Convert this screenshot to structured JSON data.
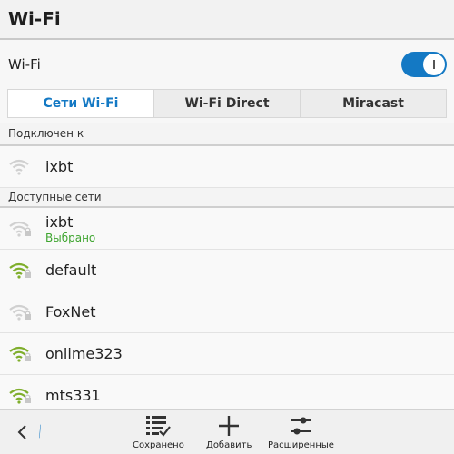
{
  "header": {
    "title": "Wi-Fi"
  },
  "wifi_toggle": {
    "label": "Wi-Fi",
    "on": true
  },
  "tabs": [
    {
      "label": "Сети Wi-Fi",
      "active": true
    },
    {
      "label": "Wi-Fi Direct",
      "active": false
    },
    {
      "label": "Miracast",
      "active": false
    }
  ],
  "connected_section": {
    "header": "Подключен к",
    "networks": [
      {
        "name": "ixbt",
        "secured": false,
        "color": "#d0d0d0"
      }
    ]
  },
  "available_section": {
    "header": "Доступные сети",
    "networks": [
      {
        "name": "ixbt",
        "status": "Выбрано",
        "secured": true,
        "color": "#d0d0d0"
      },
      {
        "name": "default",
        "secured": true,
        "color": "#7fae2c"
      },
      {
        "name": "FoxNet",
        "secured": true,
        "color": "#d0d0d0"
      },
      {
        "name": "onlime323",
        "secured": true,
        "color": "#7fae2c"
      },
      {
        "name": "mts331",
        "secured": true,
        "color": "#7fae2c"
      }
    ]
  },
  "bottom_bar": {
    "actions": [
      {
        "label": "Сохранено",
        "icon": "saved-list-icon"
      },
      {
        "label": "Добавить",
        "icon": "plus-icon"
      },
      {
        "label": "Расширенные",
        "icon": "sliders-icon"
      }
    ]
  },
  "colors": {
    "accent": "#1479c4",
    "status_green": "#3fa530",
    "signal_green": "#7fae2c"
  }
}
